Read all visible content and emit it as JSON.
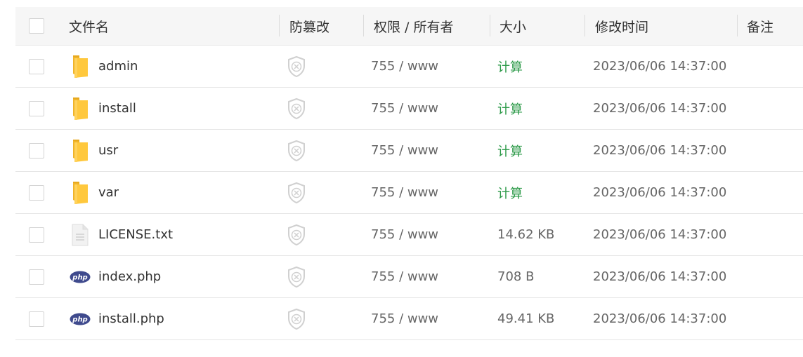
{
  "header": {
    "name": "文件名",
    "tamper": "防篡改",
    "perm": "权限 / 所有者",
    "size": "大小",
    "mtime": "修改时间",
    "note": "备注"
  },
  "colors": {
    "calc_link": "#2d9a49",
    "folder": "#ffc83d",
    "php_badge": "#3f4a8d"
  },
  "files": [
    {
      "name": "admin",
      "type": "folder",
      "perm": "755 / www",
      "size": "计算",
      "mtime": "2023/06/06 14:37:00"
    },
    {
      "name": "install",
      "type": "folder",
      "perm": "755 / www",
      "size": "计算",
      "mtime": "2023/06/06 14:37:00"
    },
    {
      "name": "usr",
      "type": "folder",
      "perm": "755 / www",
      "size": "计算",
      "mtime": "2023/06/06 14:37:00"
    },
    {
      "name": "var",
      "type": "folder",
      "perm": "755 / www",
      "size": "计算",
      "mtime": "2023/06/06 14:37:00"
    },
    {
      "name": "LICENSE.txt",
      "type": "text",
      "perm": "755 / www",
      "size": "14.62 KB",
      "mtime": "2023/06/06 14:37:00"
    },
    {
      "name": "index.php",
      "type": "php",
      "perm": "755 / www",
      "size": "708 B",
      "mtime": "2023/06/06 14:37:00"
    },
    {
      "name": "install.php",
      "type": "php",
      "perm": "755 / www",
      "size": "49.41 KB",
      "mtime": "2023/06/06 14:37:00"
    }
  ],
  "icons": {
    "php_label": "php"
  }
}
